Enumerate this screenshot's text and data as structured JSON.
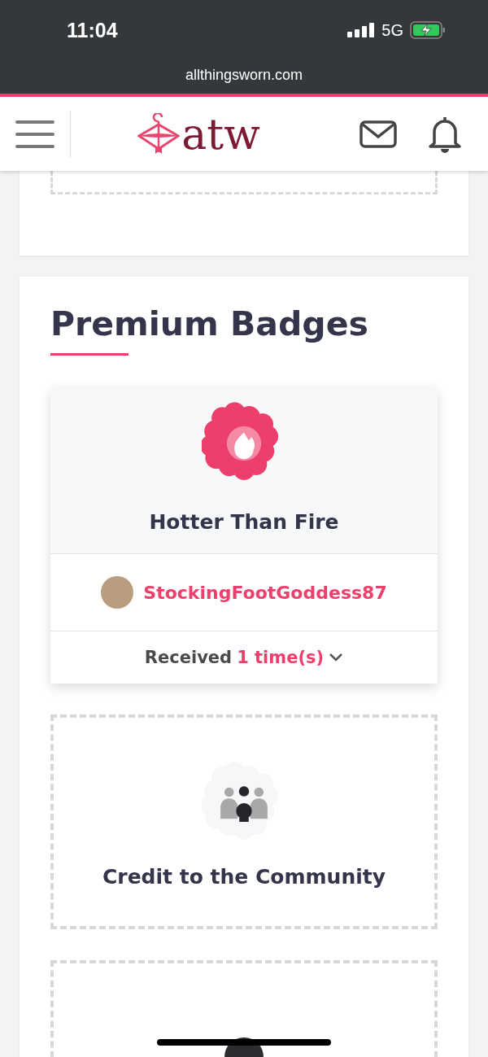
{
  "status_bar": {
    "time": "11:04",
    "network": "5G"
  },
  "browser": {
    "url": "allthingsworn.com"
  },
  "header": {
    "logo_text": "atw"
  },
  "section": {
    "title": "Premium Badges"
  },
  "badges": [
    {
      "kind": "earned",
      "name": "Hotter Than Fire",
      "user": "StockingFootGoddess87",
      "received_label": "Received",
      "received_count": "1 time(s)",
      "expanded": false
    },
    {
      "kind": "locked",
      "name": "Credit to the Community"
    },
    {
      "kind": "locked_partial"
    }
  ]
}
